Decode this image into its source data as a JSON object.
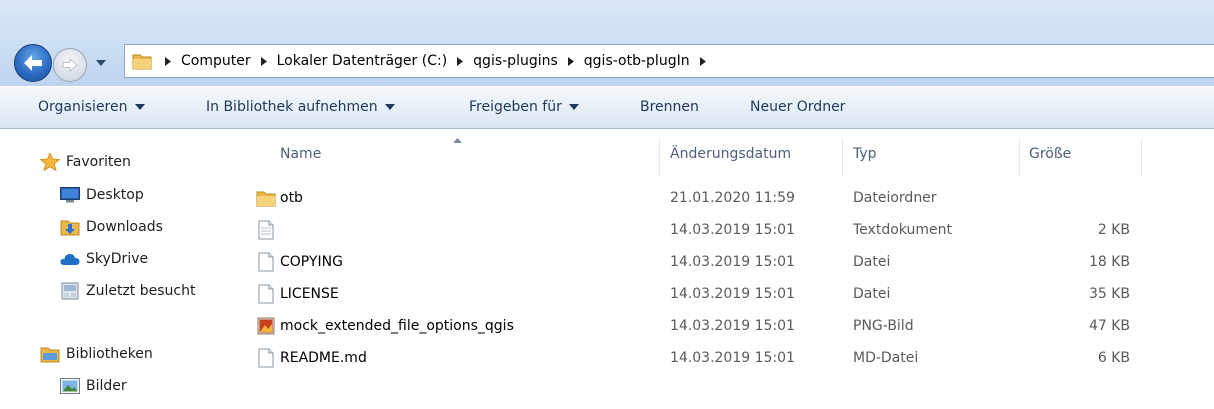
{
  "breadcrumbs": [
    "Computer",
    "Lokaler Datenträger (C:)",
    "qgis-plugins",
    "qgis-otb-plugIn"
  ],
  "toolbar": {
    "organize": "Organisieren",
    "library": "In Bibliothek aufnehmen",
    "share": "Freigeben für",
    "burn": "Brennen",
    "new_folder": "Neuer Ordner"
  },
  "nav": {
    "favorites": {
      "label": "Favoriten",
      "items": [
        {
          "label": "Desktop",
          "icon": "desktop-icon"
        },
        {
          "label": "Downloads",
          "icon": "downloads-folder-icon"
        },
        {
          "label": "SkyDrive",
          "icon": "skydrive-icon"
        },
        {
          "label": "Zuletzt besucht",
          "icon": "recent-places-icon"
        }
      ]
    },
    "libraries": {
      "label": "Bibliotheken",
      "items": [
        {
          "label": "Bilder",
          "icon": "pictures-library-icon"
        }
      ]
    }
  },
  "columns": {
    "name": "Name",
    "modified": "Änderungsdatum",
    "type": "Typ",
    "size": "Größe"
  },
  "files": [
    {
      "name": "otb",
      "modified": "21.01.2020 11:59",
      "type": "Dateiordner",
      "size": "",
      "icon": "folder-icon"
    },
    {
      "name": "",
      "modified": "14.03.2019 15:01",
      "type": "Textdokument",
      "size": "2 KB",
      "icon": "text-document-icon"
    },
    {
      "name": "COPYING",
      "modified": "14.03.2019 15:01",
      "type": "Datei",
      "size": "18 KB",
      "icon": "file-icon"
    },
    {
      "name": "LICENSE",
      "modified": "14.03.2019 15:01",
      "type": "Datei",
      "size": "35 KB",
      "icon": "file-icon"
    },
    {
      "name": "mock_extended_file_options_qgis",
      "modified": "14.03.2019 15:01",
      "type": "PNG-Bild",
      "size": "47 KB",
      "icon": "png-image-icon"
    },
    {
      "name": "README.md",
      "modified": "14.03.2019 15:01",
      "type": "MD-Datei",
      "size": "6 KB",
      "icon": "file-icon"
    }
  ],
  "colors": {
    "address_bar": "#cddff3",
    "toolbar_text": "#1e395b",
    "header_text": "#4c607a",
    "folder": "#e8b84a"
  }
}
